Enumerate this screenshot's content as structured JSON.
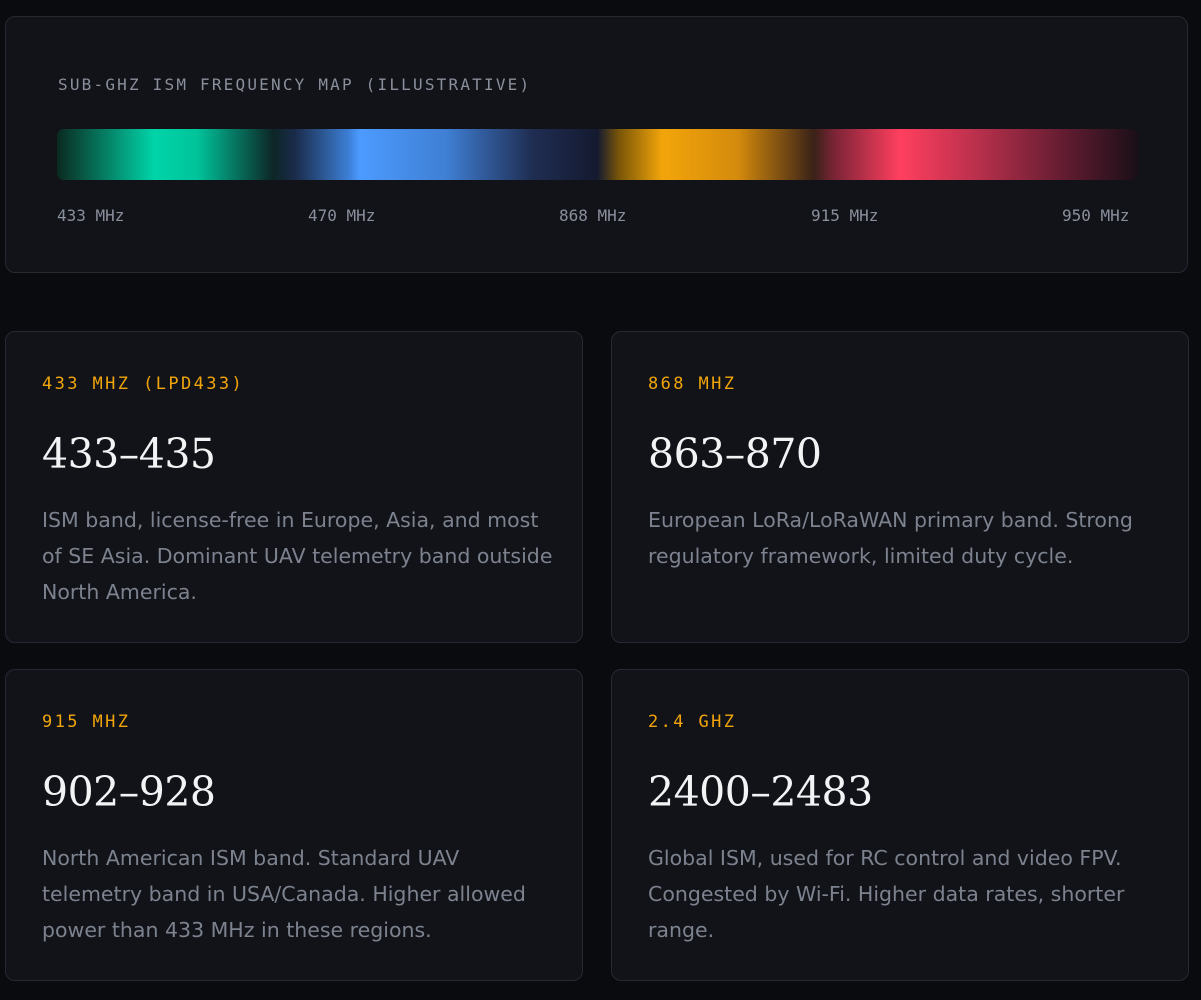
{
  "frequency_map": {
    "title": "SUB-GHZ ISM FREQUENCY MAP (ILLUSTRATIVE)",
    "ticks": [
      "433 MHz",
      "470 MHz",
      "868 MHz",
      "915 MHz",
      "950 MHz"
    ],
    "colors": {
      "teal": "#00d4a8",
      "blue": "#4c9bff",
      "amber": "#f2a50a",
      "red": "#ff3f5f"
    }
  },
  "cards": [
    {
      "label": "433 MHZ (LPD433)",
      "range": "433–435",
      "description": "ISM band, license-free in Europe, Asia, and most of SE Asia. Dominant UAV telemetry band outside North America."
    },
    {
      "label": "868 MHZ",
      "range": "863–870",
      "description": "European LoRa/LoRaWAN primary band. Strong regulatory framework, limited duty cycle."
    },
    {
      "label": "915 MHZ",
      "range": "902–928",
      "description": "North American ISM band. Standard UAV telemetry band in USA/Canada. Higher allowed power than 433 MHz in these regions."
    },
    {
      "label": "2.4 GHZ",
      "range": "2400–2483",
      "description": "Global ISM, used for RC control and video FPV. Congested by Wi-Fi. Higher data rates, shorter range."
    }
  ],
  "theme": {
    "background": "#0a0b0f",
    "card_background": "#111318",
    "accent": "#f2a50a",
    "text_muted": "#7d828f"
  }
}
